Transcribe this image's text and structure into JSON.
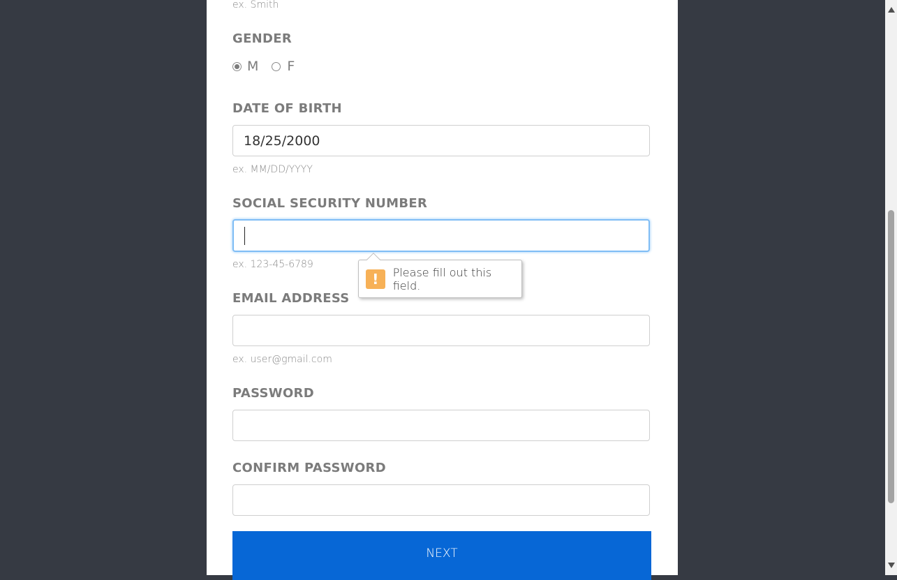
{
  "form": {
    "last_name_hint": "ex. Smith",
    "gender": {
      "label": "GENDER",
      "options": [
        {
          "label": "M",
          "selected": true
        },
        {
          "label": "F",
          "selected": false
        }
      ]
    },
    "dob": {
      "label": "DATE OF BIRTH",
      "value": "18/25/2000",
      "hint": "ex. MM/DD/YYYY"
    },
    "ssn": {
      "label": "SOCIAL SECURITY NUMBER",
      "value": "",
      "hint": "ex. 123-45-6789"
    },
    "email": {
      "label": "EMAIL ADDRESS",
      "value": "",
      "hint": "ex. user@gmail.com"
    },
    "password": {
      "label": "PASSWORD",
      "value": ""
    },
    "confirm_password": {
      "label": "CONFIRM PASSWORD",
      "value": ""
    },
    "next_label": "NEXT"
  },
  "tooltip": {
    "icon": "warning-icon",
    "icon_glyph": "!",
    "message": "Please fill out this field.",
    "icon_color": "#f7b157"
  },
  "colors": {
    "background": "#363a43",
    "button": "#0767d6"
  }
}
